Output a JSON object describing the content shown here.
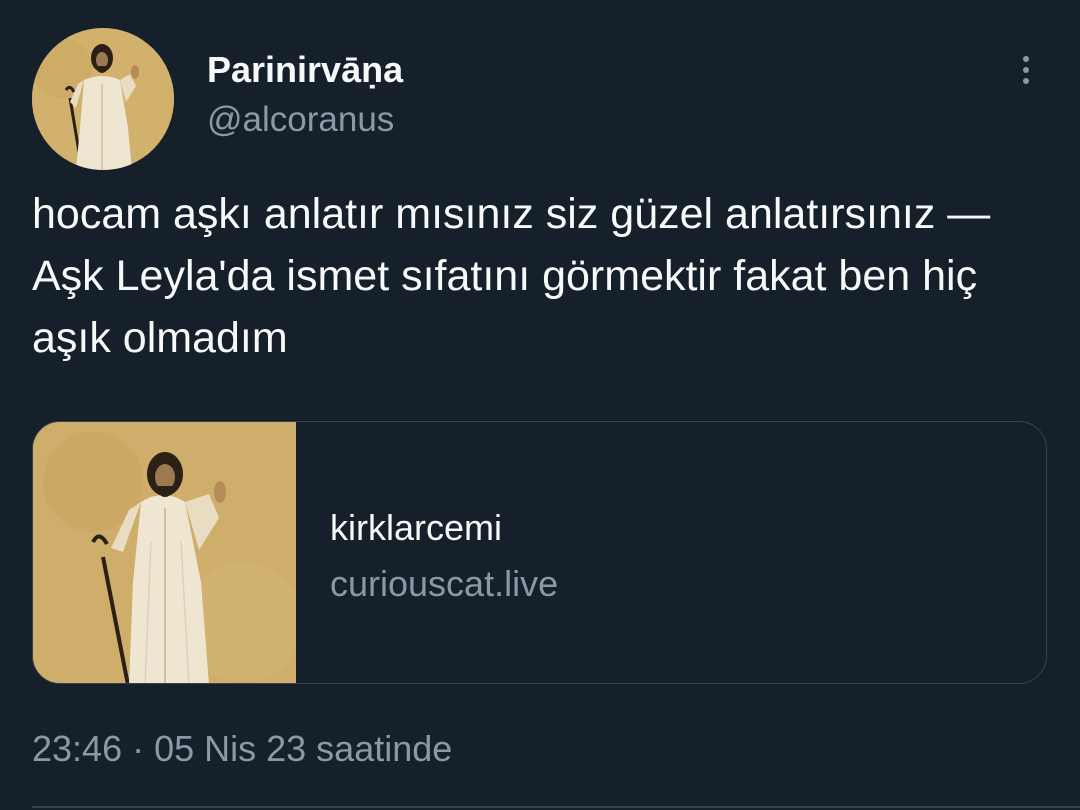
{
  "author": {
    "display_name": "Parinirvāṇa",
    "handle": "@alcoranus"
  },
  "tweet": {
    "text": "hocam aşkı anlatır mısınız siz güzel anlatırsınız — Aşk Leyla'da ismet sıfatını görmektir fakat ben hiç aşık olmadım",
    "timestamp": "23:46 · 05 Nis 23 saatinde"
  },
  "link_card": {
    "title": "kirklarcemi",
    "domain": "curiouscat.live"
  },
  "icons": {
    "more": "more-vertical-icon"
  },
  "colors": {
    "background": "#15202b",
    "primary_text": "#f7f9f9",
    "secondary_text": "#8b98a5",
    "border": "#38444d"
  }
}
